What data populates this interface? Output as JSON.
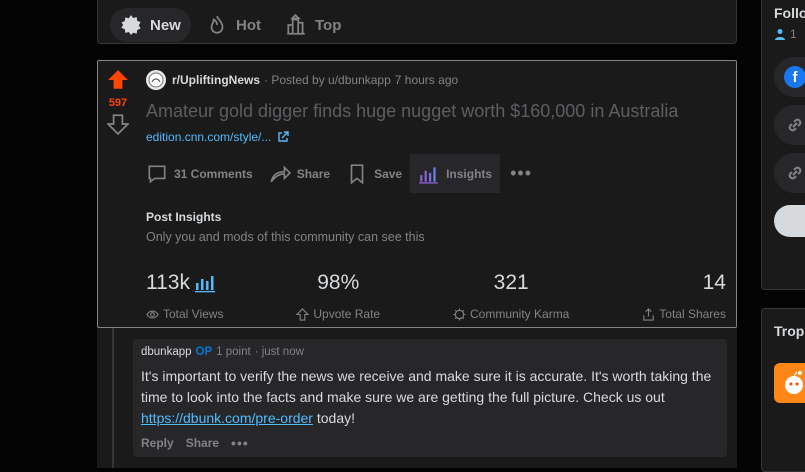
{
  "sort": {
    "new_label": "New",
    "hot_label": "Hot",
    "top_label": "Top"
  },
  "post": {
    "vote_count": "597",
    "subreddit": "r/UpliftingNews",
    "posted_by": "· Posted by u/dbunkapp",
    "time_ago": "7 hours ago",
    "title": "Amateur gold digger finds huge nugget worth $160,000 in Australia",
    "link_text": "edition.cnn.com/style/...",
    "actions": {
      "comments": "31 Comments",
      "share": "Share",
      "save": "Save",
      "insights": "Insights"
    },
    "insights": {
      "title": "Post Insights",
      "subtitle": "Only you and mods of this community can see this",
      "stats": [
        {
          "value": "113k",
          "label": "Total Views"
        },
        {
          "value": "98%",
          "label": "Upvote Rate"
        },
        {
          "value": "321",
          "label": "Community Karma"
        },
        {
          "value": "14",
          "label": "Total Shares"
        }
      ]
    }
  },
  "comment": {
    "author": "dbunkapp",
    "op_badge": "OP",
    "points": "1 point",
    "time": "· just now",
    "body_before": "It's important to verify the news we receive and make sure it is accurate. It's worth taking the time to look into the facts and make sure we are getting the full picture. Check us out ",
    "body_link": "https://dbunk.com/pre-order",
    "body_after": " today!",
    "reply": "Reply",
    "share": "Share"
  },
  "sidebar": {
    "title": "Follo",
    "count": "1",
    "title2": "Trop"
  },
  "colors": {
    "upvote": "#ff4500",
    "link": "#4fbcff",
    "op": "#0079d3"
  }
}
